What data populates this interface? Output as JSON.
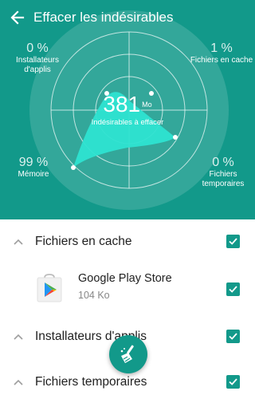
{
  "header": {
    "title": "Effacer les indésirables",
    "total_value": "381",
    "total_unit": "Mo",
    "total_label": "Indésirables à effacer"
  },
  "stats": {
    "installers": {
      "pct": "0 %",
      "label": "Installateurs d'applis"
    },
    "cache": {
      "pct": "1 %",
      "label": "Fichiers en cache"
    },
    "memory": {
      "pct": "99 %",
      "label": "Mémoire"
    },
    "temp": {
      "pct": "0 %",
      "label": "Fichiers temporaires"
    }
  },
  "sections": {
    "cache": {
      "label": "Fichiers en cache",
      "checked": true
    },
    "installers": {
      "label": "Installateurs d'applis",
      "checked": true
    },
    "temp": {
      "label": "Fichiers temporaires",
      "checked": true
    }
  },
  "apps": [
    {
      "name": "Google Play Store",
      "size": "104 Ko",
      "checked": true
    }
  ],
  "colors": {
    "accent": "#12998a",
    "radar_fill": "#2ee3d1"
  },
  "icons": {
    "back": "arrow-left-icon",
    "collapse": "chevron-up-icon",
    "checkbox": "checkbox-checked-icon",
    "fab": "broom-icon",
    "app": "play-store-icon"
  }
}
